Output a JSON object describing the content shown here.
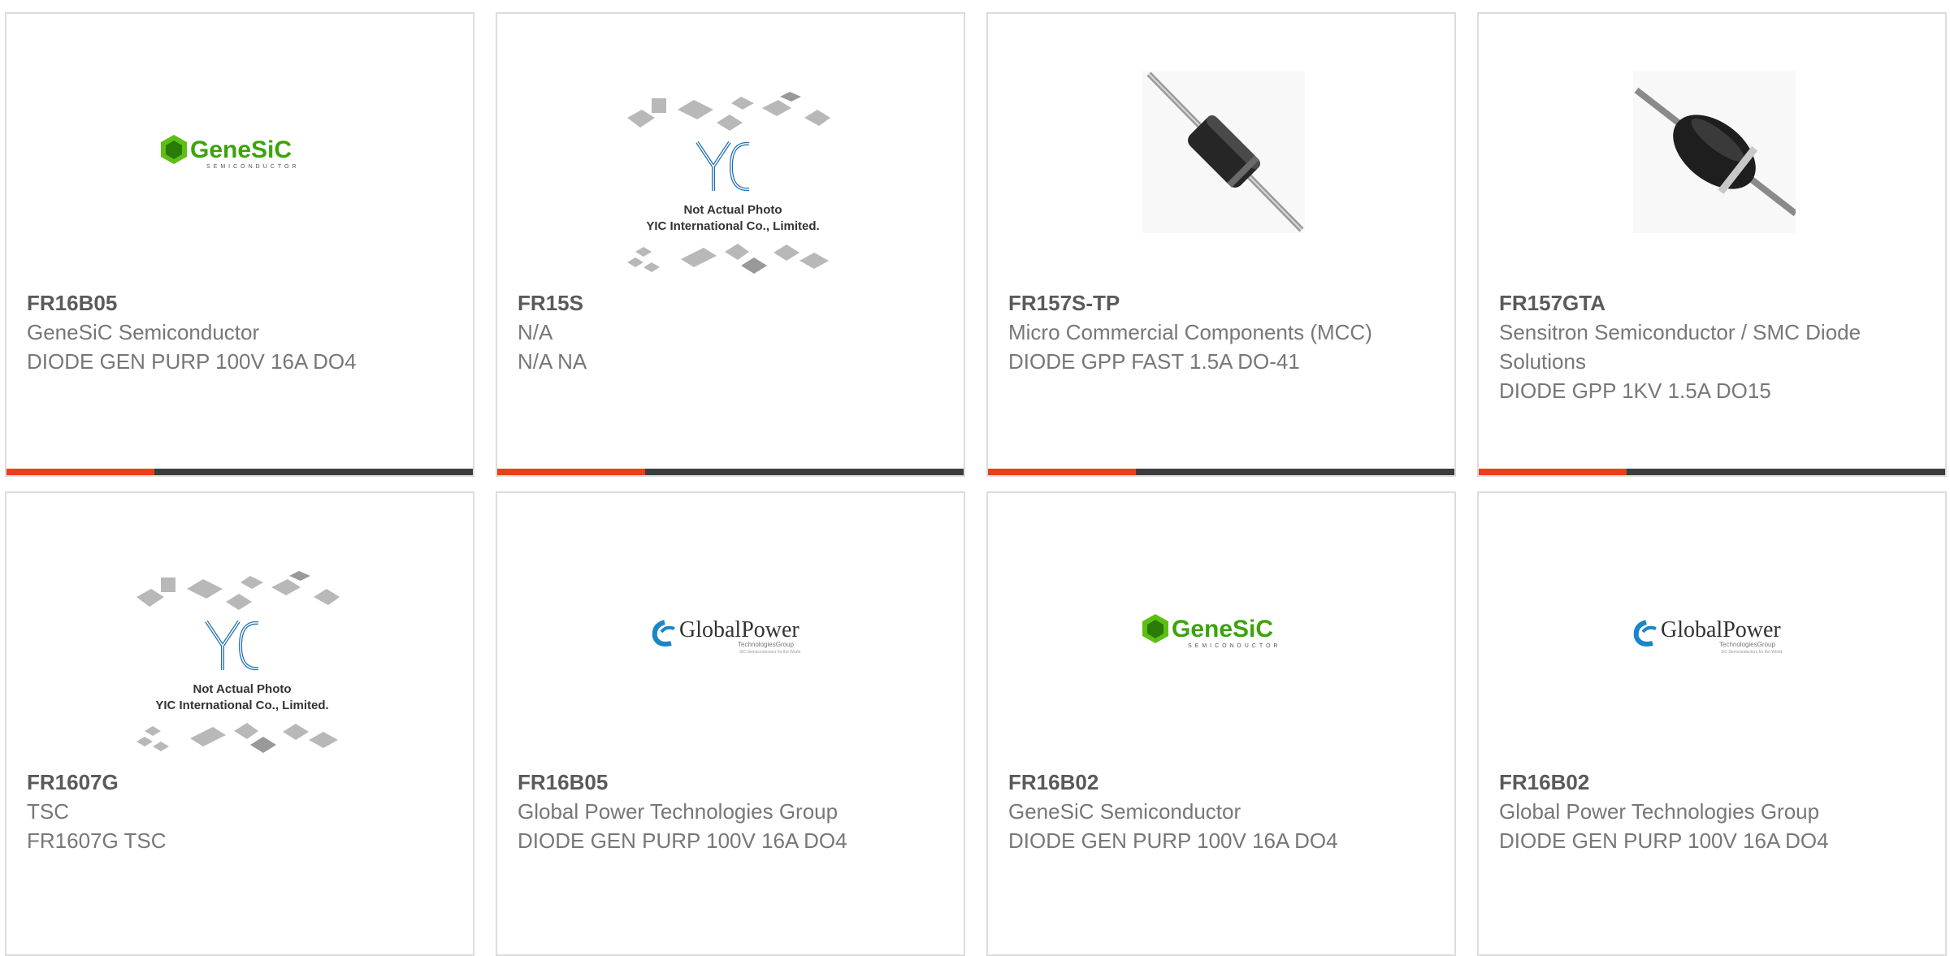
{
  "accent_color": "#e8401c",
  "bar_color": "#3c3c3c",
  "cards": [
    {
      "part": "FR16B05",
      "maker": "GeneSiC Semiconductor",
      "desc": "DIODE GEN PURP 100V 16A DO4",
      "image": "genesic-logo"
    },
    {
      "part": "FR15S",
      "maker": "N/A",
      "desc": "N/A NA",
      "image": "yic-placeholder",
      "img_text": [
        "Not Actual Photo",
        "YIC International Co., Limited."
      ]
    },
    {
      "part": "FR157S-TP",
      "maker": "Micro Commercial Components (MCC)",
      "desc": "DIODE GPP FAST 1.5A DO-41",
      "image": "axial-diode-photo"
    },
    {
      "part": "FR157GTA",
      "maker": "Sensitron Semiconductor / SMC Diode Solutions",
      "desc": "DIODE GPP 1KV 1.5A DO15",
      "image": "axial-diode-photo"
    },
    {
      "part": "FR1607G",
      "maker": "TSC",
      "desc": "FR1607G TSC",
      "image": "yic-placeholder",
      "img_text": [
        "Not Actual Photo",
        "YIC International Co., Limited."
      ]
    },
    {
      "part": "FR16B05",
      "maker": "Global Power Technologies Group",
      "desc": "DIODE GEN PURP 100V 16A DO4",
      "image": "globalpower-logo"
    },
    {
      "part": "FR16B02",
      "maker": "GeneSiC Semiconductor",
      "desc": "DIODE GEN PURP 100V 16A DO4",
      "image": "genesic-logo"
    },
    {
      "part": "FR16B02",
      "maker": "Global Power Technologies Group",
      "desc": "DIODE GEN PURP 100V 16A DO4",
      "image": "globalpower-logo"
    }
  ]
}
